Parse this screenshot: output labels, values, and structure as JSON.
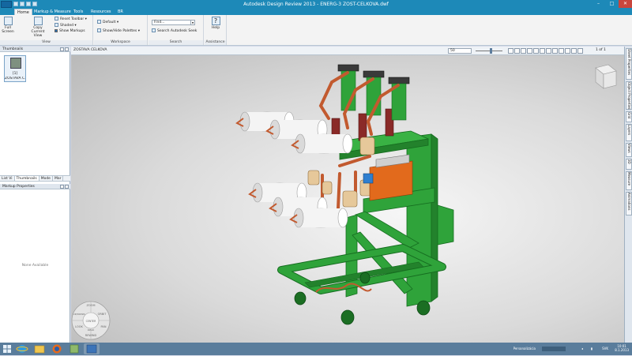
{
  "window": {
    "title": "Autodesk Design Review 2013  -  ENERG-3 ZOST-CELKOVA.dwf",
    "min_glyph": "–",
    "max_glyph": "□",
    "close_glyph": "✕"
  },
  "tabs": [
    "Home",
    "Markup & Measure",
    "Tools",
    "Resources",
    "BR"
  ],
  "ribbon": {
    "view": {
      "label": "View",
      "full_screen": "Full Screen",
      "copy_current_view": "Copy Current View",
      "reset_toolbar": "Reset Toolbar",
      "shaded": "Shaded",
      "show_markups": "Show Markups"
    },
    "workspace": {
      "label": "Workspace",
      "default": "Default",
      "show_hide_palettes": "Show/Hide Palettes"
    },
    "search": {
      "label": "Search",
      "find_placeholder": "Find...",
      "search_autodesk_seek": "Search Autodesk Seek"
    },
    "assistance": {
      "label": "Assistance",
      "help": "Help"
    }
  },
  "left_panel": {
    "thumbnails_title": "Thumbnails",
    "thumb_number": "[1]",
    "thumb_name": "ZOSTAVA C...",
    "subtabs": [
      "List Vi",
      "Thumbnails",
      "Mode",
      "Mar"
    ],
    "markup_title": "Markup Properties",
    "none_available": "None Available"
  },
  "canvas": {
    "breadcrumb": "ZOSTAVA CELKOVA",
    "zoom_value": "50",
    "page_indicator": "1 of 1",
    "wheel_labels": [
      "ZOOM",
      "ORBIT",
      "PAN",
      "REWIND",
      "CENTER",
      "LOOK",
      "UP/DOWN",
      "WALK"
    ]
  },
  "right_dock": {
    "tabs": [
      "Sheet Properties",
      "Object Properties",
      "Grid",
      "Layers",
      "Views",
      "3D",
      "Measure",
      "Animations"
    ]
  },
  "taskbar": {
    "apps": [
      "start",
      "internet-explorer",
      "file-explorer",
      "firefox",
      "files",
      "design-review"
    ],
    "tray_text": "Personalizácia",
    "clock_time": "10:01",
    "clock_date": "8.1.2013",
    "lang": "SVK"
  },
  "colors": {
    "frame_green": "#2fa33a",
    "insulator_white": "#efefef",
    "copper": "#c25a2f",
    "dark_red": "#8a2a28",
    "orange_box": "#e26a1c",
    "title_blue": "#1d89b8"
  }
}
